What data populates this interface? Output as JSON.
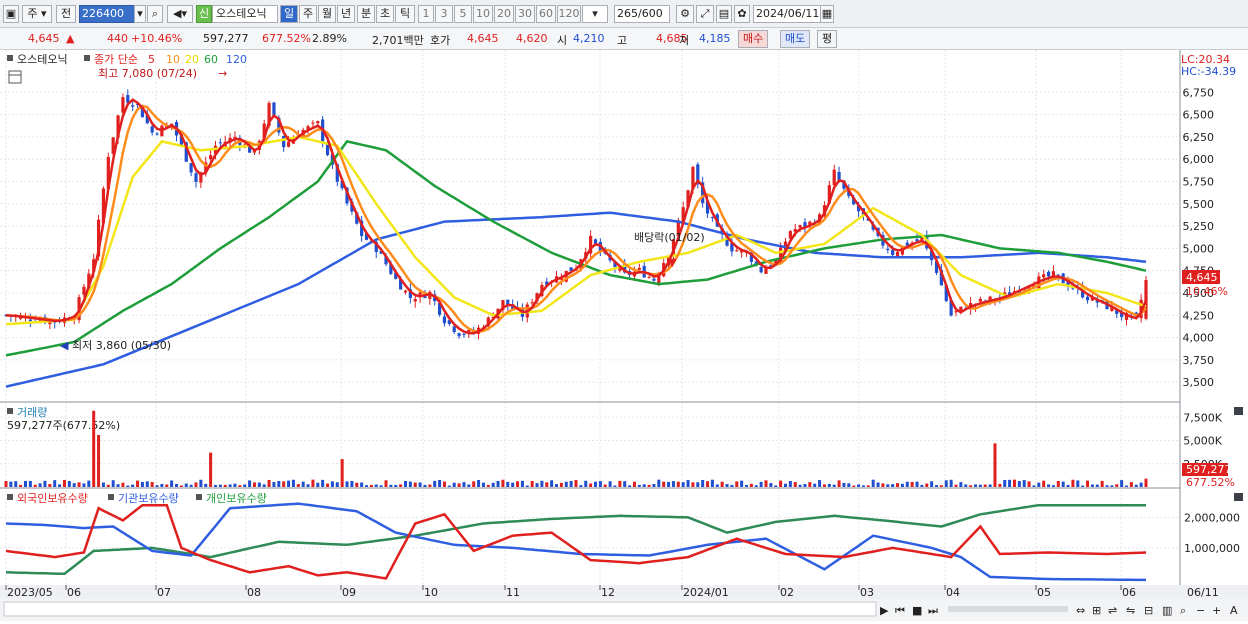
{
  "toolbar": {
    "type_label": "주",
    "market_label": "전",
    "code": "226400",
    "stock_tag": "신",
    "stock_name": "오스테오닉",
    "period_day": "일",
    "period_week": "주",
    "period_month": "월",
    "period_year": "년",
    "period_min": "분",
    "period_sec": "초",
    "period_tick": "틱",
    "intervals": [
      "1",
      "3",
      "5",
      "10",
      "20",
      "30",
      "60",
      "120"
    ],
    "count": "265",
    "count_total": "/600",
    "date": "2024/06/11"
  },
  "quote": {
    "price": "4,645",
    "change": "440",
    "change_pct": "+10.46%",
    "volume": "597,277",
    "volume_pct": "677.52%",
    "turnover_pct": "2.89%",
    "amount": "2,701백만",
    "bid_label": "호가",
    "bid1": "4,645",
    "bid2": "4,620",
    "open_label": "시",
    "open": "4,210",
    "high_label": "고",
    "high": "4,685",
    "low_label": "저",
    "low": "4,185",
    "buy_label": "매수",
    "sell_label": "매도",
    "avg_label": "평"
  },
  "legend": {
    "name": "오스테오닉",
    "ma_label": "종가 단순",
    "ma_periods": [
      "5",
      "10",
      "20",
      "60",
      "120"
    ],
    "high_note": "최고 7,080 (07/24)",
    "low_note": "최저 3,860 (05/30)",
    "dividend_note": "배당락(01/02)",
    "lc": "LC:20.34",
    "hc": "HC:-34.39",
    "price_tag": "4,645",
    "pct_tag": "10.46%"
  },
  "volume_panel": {
    "title": "거래량",
    "value": "597,277주(677.52%)",
    "tag_value": "597,277",
    "tag_pct": "677.52%"
  },
  "holdings_panel": {
    "series": [
      "외국인보유수량",
      "기관보유수량",
      "개인보유수량"
    ]
  },
  "x_axis": [
    "2023/05",
    "06",
    "07",
    "08",
    "09",
    "10",
    "11",
    "12",
    "2024/01",
    "02",
    "03",
    "04",
    "05",
    "06"
  ],
  "x_last": "06/11",
  "colors": {
    "up": "#e01f1f",
    "down": "#1f4fcf",
    "ma5": "#e01f1f",
    "ma10": "#ff8c1a",
    "ma20": "#f2e619",
    "ma60": "#1e9e3a",
    "ma120": "#2f5ee0"
  },
  "chart_data": {
    "type": "candlestick",
    "price_axis": {
      "ticks": [
        3500,
        3750,
        4000,
        4250,
        4500,
        4750,
        5000,
        5250,
        5500,
        5750,
        6000,
        6250,
        6500,
        6750
      ],
      "ylim": [
        3300,
        7000
      ]
    },
    "volume_axis": {
      "ticks": [
        "2,500K",
        "5,000K",
        "7,500K"
      ],
      "ylim": [
        0,
        8500
      ]
    },
    "holdings_axis": {
      "ticks": [
        "1,000,000",
        "2,000,000"
      ],
      "ylim": [
        -150000,
        2700000
      ]
    },
    "close_points": [
      {
        "t": 0,
        "v": 4250
      },
      {
        "t": 10,
        "v": 4180
      },
      {
        "t": 14,
        "v": 4250
      },
      {
        "t": 18,
        "v": 4900
      },
      {
        "t": 21,
        "v": 6050
      },
      {
        "t": 24,
        "v": 6700
      },
      {
        "t": 27,
        "v": 6600
      },
      {
        "t": 30,
        "v": 6300
      },
      {
        "t": 34,
        "v": 6400
      },
      {
        "t": 39,
        "v": 5750
      },
      {
        "t": 43,
        "v": 6150
      },
      {
        "t": 47,
        "v": 6250
      },
      {
        "t": 51,
        "v": 6050
      },
      {
        "t": 54,
        "v": 6600
      },
      {
        "t": 57,
        "v": 6150
      },
      {
        "t": 60,
        "v": 6300
      },
      {
        "t": 64,
        "v": 6400
      },
      {
        "t": 67,
        "v": 5900
      },
      {
        "t": 70,
        "v": 5500
      },
      {
        "t": 73,
        "v": 5150
      },
      {
        "t": 76,
        "v": 5000
      },
      {
        "t": 80,
        "v": 4650
      },
      {
        "t": 83,
        "v": 4450
      },
      {
        "t": 87,
        "v": 4500
      },
      {
        "t": 90,
        "v": 4200
      },
      {
        "t": 93,
        "v": 4050
      },
      {
        "t": 96,
        "v": 4050
      },
      {
        "t": 99,
        "v": 4200
      },
      {
        "t": 102,
        "v": 4400
      },
      {
        "t": 106,
        "v": 4250
      },
      {
        "t": 110,
        "v": 4600
      },
      {
        "t": 114,
        "v": 4700
      },
      {
        "t": 117,
        "v": 4800
      },
      {
        "t": 120,
        "v": 5100
      },
      {
        "t": 123,
        "v": 4900
      },
      {
        "t": 127,
        "v": 4700
      },
      {
        "t": 130,
        "v": 4750
      },
      {
        "t": 133,
        "v": 4650
      },
      {
        "t": 136,
        "v": 4950
      },
      {
        "t": 139,
        "v": 5450
      },
      {
        "t": 141,
        "v": 5900
      },
      {
        "t": 143,
        "v": 5500
      },
      {
        "t": 146,
        "v": 5200
      },
      {
        "t": 149,
        "v": 5000
      },
      {
        "t": 152,
        "v": 4950
      },
      {
        "t": 155,
        "v": 4750
      },
      {
        "t": 158,
        "v": 4850
      },
      {
        "t": 161,
        "v": 5200
      },
      {
        "t": 164,
        "v": 5250
      },
      {
        "t": 167,
        "v": 5350
      },
      {
        "t": 170,
        "v": 5850
      },
      {
        "t": 173,
        "v": 5550
      },
      {
        "t": 176,
        "v": 5350
      },
      {
        "t": 179,
        "v": 5100
      },
      {
        "t": 182,
        "v": 4950
      },
      {
        "t": 185,
        "v": 5050
      },
      {
        "t": 188,
        "v": 5100
      },
      {
        "t": 191,
        "v": 4750
      },
      {
        "t": 194,
        "v": 4250
      },
      {
        "t": 197,
        "v": 4350
      },
      {
        "t": 200,
        "v": 4400
      },
      {
        "t": 204,
        "v": 4450
      },
      {
        "t": 208,
        "v": 4550
      },
      {
        "t": 212,
        "v": 4650
      },
      {
        "t": 215,
        "v": 4700
      },
      {
        "t": 218,
        "v": 4600
      },
      {
        "t": 222,
        "v": 4450
      },
      {
        "t": 226,
        "v": 4350
      },
      {
        "t": 229,
        "v": 4250
      },
      {
        "t": 232,
        "v": 4200
      },
      {
        "t": 234,
        "v": 4645
      }
    ],
    "ma20_points": [
      {
        "t": 0,
        "v": 4150
      },
      {
        "t": 14,
        "v": 4200
      },
      {
        "t": 20,
        "v": 4800
      },
      {
        "t": 26,
        "v": 5800
      },
      {
        "t": 32,
        "v": 6200
      },
      {
        "t": 40,
        "v": 6100
      },
      {
        "t": 50,
        "v": 6150
      },
      {
        "t": 60,
        "v": 6250
      },
      {
        "t": 68,
        "v": 6150
      },
      {
        "t": 76,
        "v": 5500
      },
      {
        "t": 84,
        "v": 4900
      },
      {
        "t": 92,
        "v": 4450
      },
      {
        "t": 100,
        "v": 4250
      },
      {
        "t": 110,
        "v": 4300
      },
      {
        "t": 120,
        "v": 4700
      },
      {
        "t": 130,
        "v": 4850
      },
      {
        "t": 140,
        "v": 4950
      },
      {
        "t": 150,
        "v": 5150
      },
      {
        "t": 158,
        "v": 4950
      },
      {
        "t": 168,
        "v": 5050
      },
      {
        "t": 178,
        "v": 5450
      },
      {
        "t": 188,
        "v": 5150
      },
      {
        "t": 196,
        "v": 4700
      },
      {
        "t": 206,
        "v": 4450
      },
      {
        "t": 216,
        "v": 4600
      },
      {
        "t": 226,
        "v": 4500
      },
      {
        "t": 234,
        "v": 4350
      }
    ],
    "ma60_points": [
      {
        "t": 0,
        "v": 3800
      },
      {
        "t": 14,
        "v": 3950
      },
      {
        "t": 24,
        "v": 4300
      },
      {
        "t": 34,
        "v": 4600
      },
      {
        "t": 44,
        "v": 5000
      },
      {
        "t": 54,
        "v": 5350
      },
      {
        "t": 64,
        "v": 5750
      },
      {
        "t": 70,
        "v": 6200
      },
      {
        "t": 78,
        "v": 6100
      },
      {
        "t": 88,
        "v": 5700
      },
      {
        "t": 100,
        "v": 5300
      },
      {
        "t": 112,
        "v": 4950
      },
      {
        "t": 124,
        "v": 4700
      },
      {
        "t": 134,
        "v": 4600
      },
      {
        "t": 144,
        "v": 4650
      },
      {
        "t": 156,
        "v": 4850
      },
      {
        "t": 168,
        "v": 5000
      },
      {
        "t": 180,
        "v": 5100
      },
      {
        "t": 192,
        "v": 5150
      },
      {
        "t": 204,
        "v": 5000
      },
      {
        "t": 216,
        "v": 4950
      },
      {
        "t": 226,
        "v": 4850
      },
      {
        "t": 234,
        "v": 4750
      }
    ],
    "ma120_points": [
      {
        "t": 0,
        "v": 3450
      },
      {
        "t": 20,
        "v": 3700
      },
      {
        "t": 40,
        "v": 4150
      },
      {
        "t": 60,
        "v": 4600
      },
      {
        "t": 76,
        "v": 5100
      },
      {
        "t": 90,
        "v": 5300
      },
      {
        "t": 110,
        "v": 5350
      },
      {
        "t": 124,
        "v": 5400
      },
      {
        "t": 138,
        "v": 5300
      },
      {
        "t": 152,
        "v": 5100
      },
      {
        "t": 166,
        "v": 4950
      },
      {
        "t": 180,
        "v": 4900
      },
      {
        "t": 196,
        "v": 4900
      },
      {
        "t": 212,
        "v": 4950
      },
      {
        "t": 226,
        "v": 4900
      },
      {
        "t": 234,
        "v": 4850
      }
    ],
    "volume_spikes": [
      {
        "t": 18,
        "v": 8200
      },
      {
        "t": 19,
        "v": 5600
      },
      {
        "t": 42,
        "v": 3700
      },
      {
        "t": 69,
        "v": 3000
      },
      {
        "t": 203,
        "v": 4700
      },
      {
        "t": 234,
        "v": 900
      }
    ],
    "foreign_points": [
      {
        "t": 0,
        "v": 900000
      },
      {
        "t": 10,
        "v": 700000
      },
      {
        "t": 16,
        "v": 850000
      },
      {
        "t": 19,
        "v": 2300000
      },
      {
        "t": 24,
        "v": 1900000
      },
      {
        "t": 28,
        "v": 2400000
      },
      {
        "t": 33,
        "v": 2400000
      },
      {
        "t": 36,
        "v": 1000000
      },
      {
        "t": 42,
        "v": 600000
      },
      {
        "t": 50,
        "v": 200000
      },
      {
        "t": 58,
        "v": 400000
      },
      {
        "t": 64,
        "v": 100000
      },
      {
        "t": 70,
        "v": 200000
      },
      {
        "t": 78,
        "v": 0
      },
      {
        "t": 84,
        "v": 1800000
      },
      {
        "t": 90,
        "v": 2100000
      },
      {
        "t": 96,
        "v": 900000
      },
      {
        "t": 104,
        "v": 1400000
      },
      {
        "t": 112,
        "v": 1500000
      },
      {
        "t": 120,
        "v": 600000
      },
      {
        "t": 130,
        "v": 500000
      },
      {
        "t": 140,
        "v": 700000
      },
      {
        "t": 150,
        "v": 1300000
      },
      {
        "t": 160,
        "v": 800000
      },
      {
        "t": 172,
        "v": 700000
      },
      {
        "t": 182,
        "v": 1000000
      },
      {
        "t": 194,
        "v": 700000
      },
      {
        "t": 200,
        "v": 1700000
      },
      {
        "t": 204,
        "v": 800000
      },
      {
        "t": 214,
        "v": 850000
      },
      {
        "t": 226,
        "v": 800000
      },
      {
        "t": 234,
        "v": 850000
      }
    ],
    "inst_points": [
      {
        "t": 0,
        "v": 1800000
      },
      {
        "t": 8,
        "v": 1750000
      },
      {
        "t": 16,
        "v": 1650000
      },
      {
        "t": 22,
        "v": 1700000
      },
      {
        "t": 30,
        "v": 900000
      },
      {
        "t": 38,
        "v": 750000
      },
      {
        "t": 46,
        "v": 2300000
      },
      {
        "t": 60,
        "v": 2450000
      },
      {
        "t": 72,
        "v": 2200000
      },
      {
        "t": 80,
        "v": 1500000
      },
      {
        "t": 92,
        "v": 1100000
      },
      {
        "t": 104,
        "v": 1000000
      },
      {
        "t": 118,
        "v": 800000
      },
      {
        "t": 132,
        "v": 750000
      },
      {
        "t": 144,
        "v": 1100000
      },
      {
        "t": 156,
        "v": 1300000
      },
      {
        "t": 168,
        "v": 300000
      },
      {
        "t": 178,
        "v": 1400000
      },
      {
        "t": 190,
        "v": 1000000
      },
      {
        "t": 196,
        "v": 700000
      },
      {
        "t": 202,
        "v": 50000
      },
      {
        "t": 214,
        "v": -20000
      },
      {
        "t": 234,
        "v": -50000
      }
    ],
    "retail_points": [
      {
        "t": 0,
        "v": 200000
      },
      {
        "t": 12,
        "v": 150000
      },
      {
        "t": 18,
        "v": 900000
      },
      {
        "t": 30,
        "v": 1000000
      },
      {
        "t": 42,
        "v": 700000
      },
      {
        "t": 56,
        "v": 1200000
      },
      {
        "t": 70,
        "v": 1100000
      },
      {
        "t": 84,
        "v": 1400000
      },
      {
        "t": 98,
        "v": 1800000
      },
      {
        "t": 112,
        "v": 1950000
      },
      {
        "t": 126,
        "v": 2050000
      },
      {
        "t": 140,
        "v": 2000000
      },
      {
        "t": 148,
        "v": 1500000
      },
      {
        "t": 158,
        "v": 1850000
      },
      {
        "t": 170,
        "v": 2050000
      },
      {
        "t": 180,
        "v": 1900000
      },
      {
        "t": 192,
        "v": 1700000
      },
      {
        "t": 200,
        "v": 2100000
      },
      {
        "t": 212,
        "v": 2400000
      },
      {
        "t": 226,
        "v": 2400000
      },
      {
        "t": 234,
        "v": 2400000
      }
    ]
  }
}
